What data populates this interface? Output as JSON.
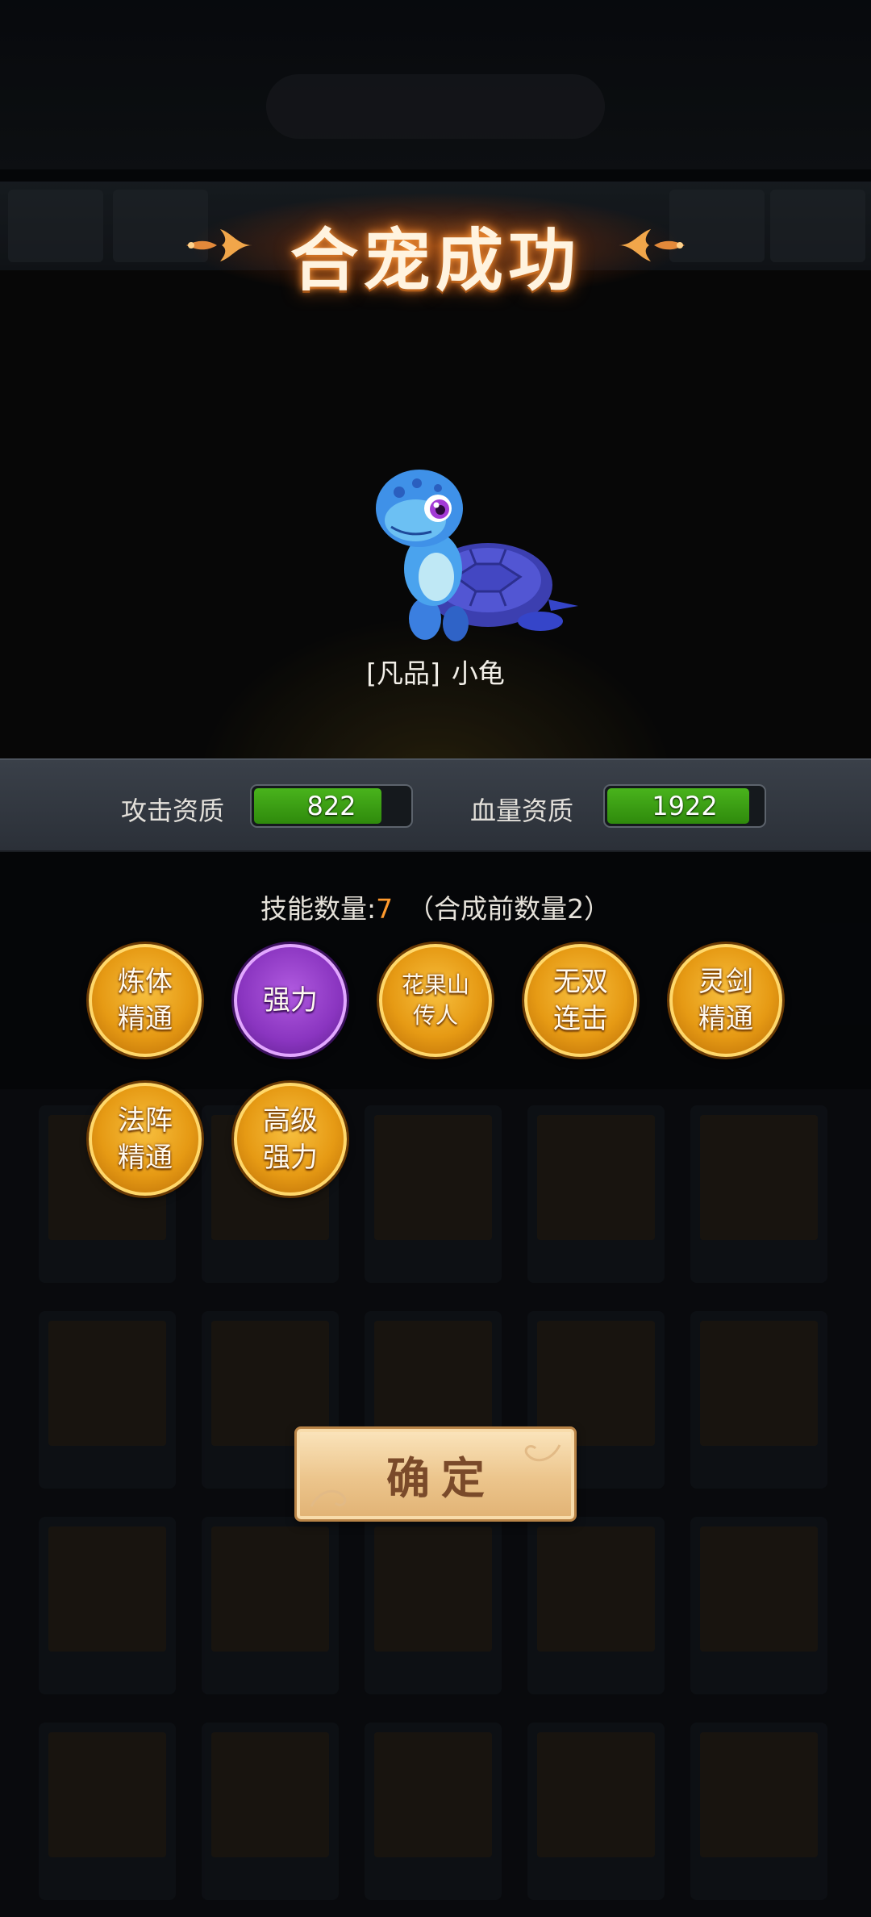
{
  "dialog": {
    "title": "合宠成功"
  },
  "pet": {
    "quality": "[凡品]",
    "name": "小龟"
  },
  "stats": [
    {
      "label": "攻击资质",
      "value": "822",
      "fill_fraction": 0.83
    },
    {
      "label": "血量资质",
      "value": "1922",
      "fill_fraction": 0.92
    }
  ],
  "skills_summary": {
    "label": "技能数量:",
    "count": "7",
    "before_note": "（合成前数量2）"
  },
  "skills": [
    {
      "label": "炼体\n精通",
      "style": "gold"
    },
    {
      "label": "强力",
      "style": "purple"
    },
    {
      "label": "花果山\n传人",
      "style": "gold"
    },
    {
      "label": "无双\n连击",
      "style": "gold"
    },
    {
      "label": "灵剑\n精通",
      "style": "gold"
    },
    {
      "label": "法阵\n精通",
      "style": "gold"
    },
    {
      "label": "高级\n强力",
      "style": "gold"
    }
  ],
  "confirm_label": "确定",
  "colors": {
    "title_glow": "#c25a14",
    "count_highlight": "#ff9a2e",
    "stat_fill": "#3f9f16",
    "skill_gold": "#e69a14",
    "skill_purple": "#8a35c0",
    "button_face": "#ecc58c"
  }
}
